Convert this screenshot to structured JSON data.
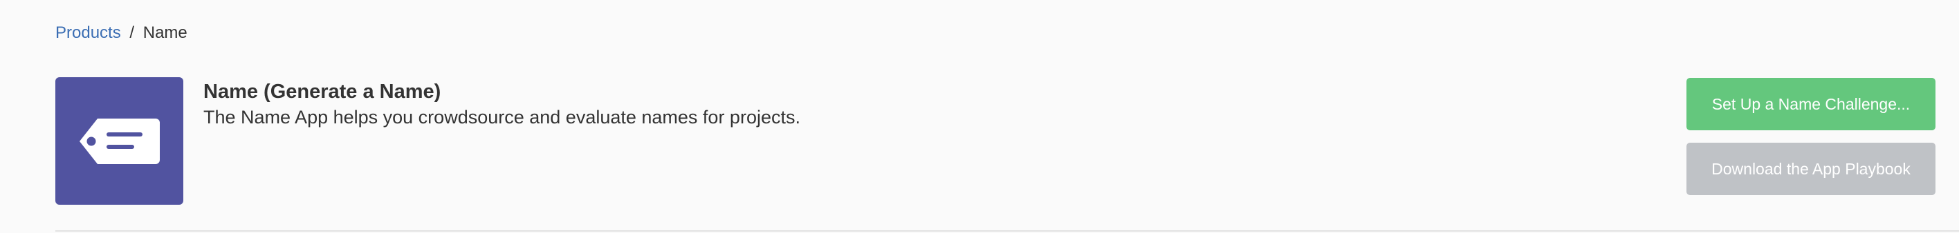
{
  "breadcrumb": {
    "parent_label": "Products",
    "separator": "/",
    "current_label": "Name"
  },
  "app": {
    "icon": "tag-icon",
    "icon_color": "#5153a0",
    "title": "Name (Generate a Name)",
    "description": "The Name App helps you crowdsource and evaluate names for projects."
  },
  "actions": {
    "primary_label": "Set Up a Name Challenge...",
    "primary_color": "#64c77d",
    "secondary_label": "Download the App Playbook",
    "secondary_color": "#bfc2c6"
  }
}
